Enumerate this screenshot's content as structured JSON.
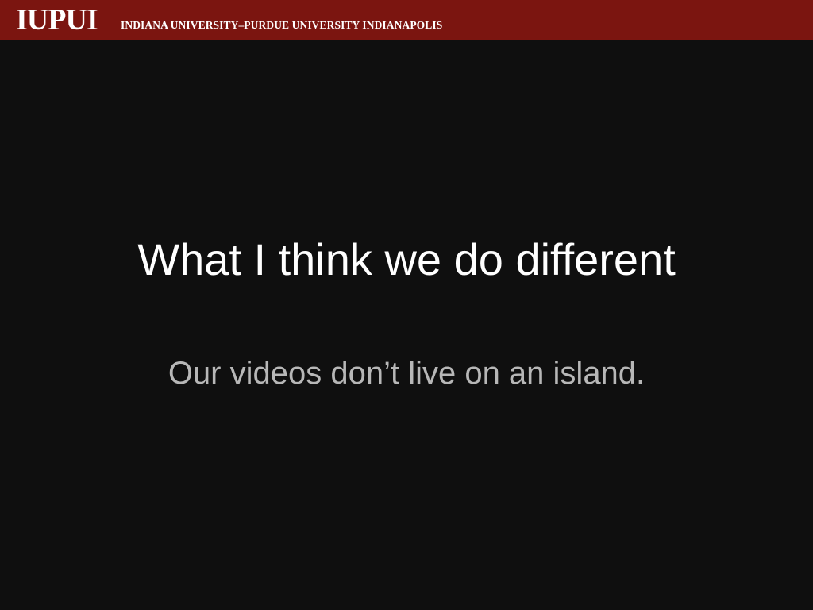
{
  "header": {
    "logo_text": "IUPUI",
    "university_name": "INDIANA UNIVERSITY–PURDUE UNIVERSITY INDIANAPOLIS"
  },
  "slide": {
    "title": "What I think we do different",
    "subtitle": "Our videos don’t live on an island."
  },
  "colors": {
    "header_background": "#7b1510",
    "slide_background": "#0f0f0f",
    "title_text": "#ffffff",
    "subtitle_text": "#b7b7b7"
  }
}
